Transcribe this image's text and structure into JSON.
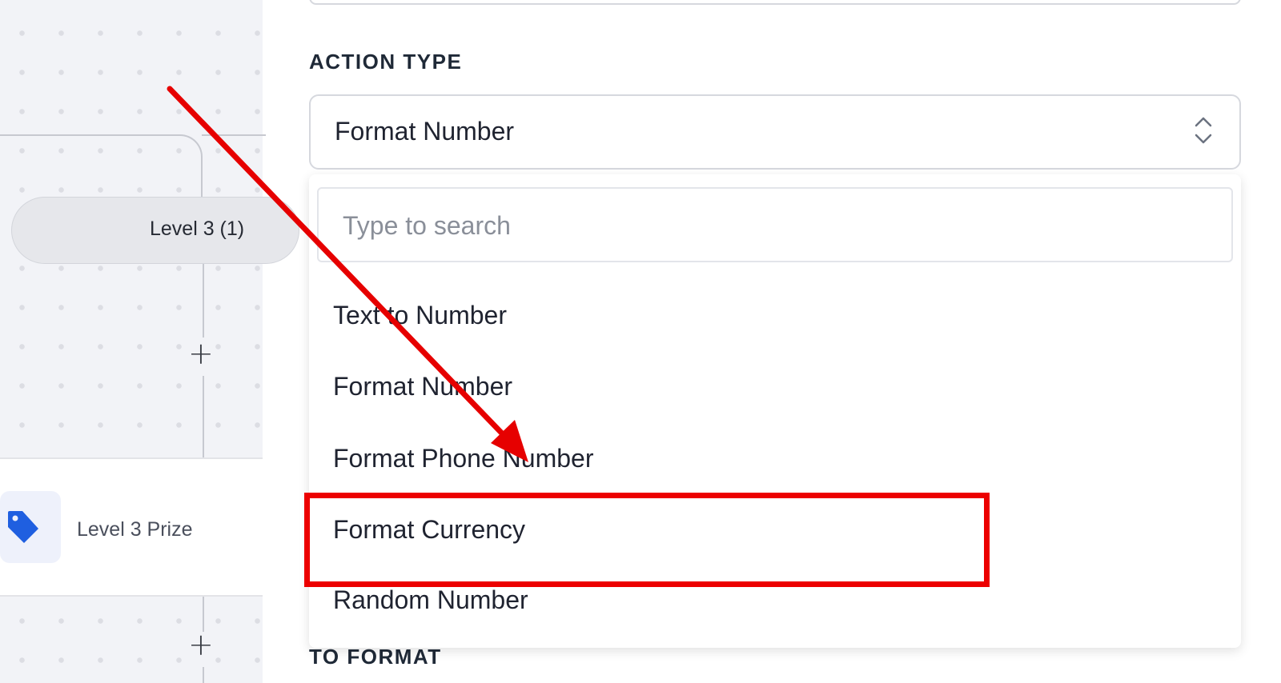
{
  "canvas": {
    "level_node_label": "Level 3 (1)",
    "prize_label": "Level 3 Prize",
    "add_step_symbol": "+"
  },
  "panel": {
    "action_type_label": "ACTION TYPE",
    "selected_action": "Format Number",
    "search_placeholder": "Type to search",
    "options": [
      "Text to Number",
      "Format Number",
      "Format Phone Number",
      "Format Currency",
      "Random Number"
    ],
    "highlighted_option": "Format Currency",
    "to_format_label": "TO FORMAT"
  },
  "annotation": {
    "arrow_color": "#e60000",
    "highlight_color": "#ec0000"
  },
  "icons": {
    "tag": "tag-icon",
    "chevron": "chevron-updown-icon"
  },
  "colors": {
    "tag_blue": "#1f5fe0",
    "canvas_bg": "#f2f3f7"
  }
}
